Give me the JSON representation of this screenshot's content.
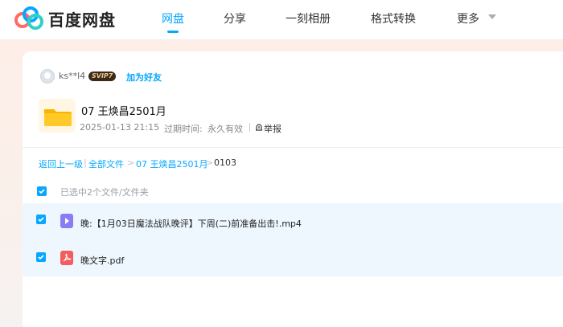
{
  "app": {
    "logo_text": "百度网盘",
    "brand_color": "#06a7ff"
  },
  "nav": {
    "items": [
      {
        "label": "网盘",
        "active": true
      },
      {
        "label": "分享",
        "active": false
      },
      {
        "label": "一刻相册",
        "active": false
      },
      {
        "label": "格式转换",
        "active": false
      },
      {
        "label": "更多",
        "active": false
      }
    ]
  },
  "share": {
    "username": "ks**l4",
    "vip_badge": "SVIP7",
    "add_friend_label": "加为好友",
    "folder_title": "07 王焕昌2501月",
    "date": "2025-01-13 21:15",
    "expiry_label": "过期时间:",
    "expiry_value": "永久有效",
    "report_label": "举报"
  },
  "breadcrumb": {
    "back_label": "返回上一级",
    "divider": "|",
    "items": [
      "全部文件",
      "07 王焕昌2501月",
      "0103"
    ],
    "separator": ">"
  },
  "selection": {
    "text": "已选中2个文件/文件夹"
  },
  "files": [
    {
      "name": "晚:【1月03日魔法战队晚评】下周(二)前准备出击!.mp4",
      "type": "video",
      "icon": "video-file-icon",
      "checked": true
    },
    {
      "name": "晚文字.pdf",
      "type": "pdf",
      "icon": "pdf-file-icon",
      "checked": true
    }
  ]
}
